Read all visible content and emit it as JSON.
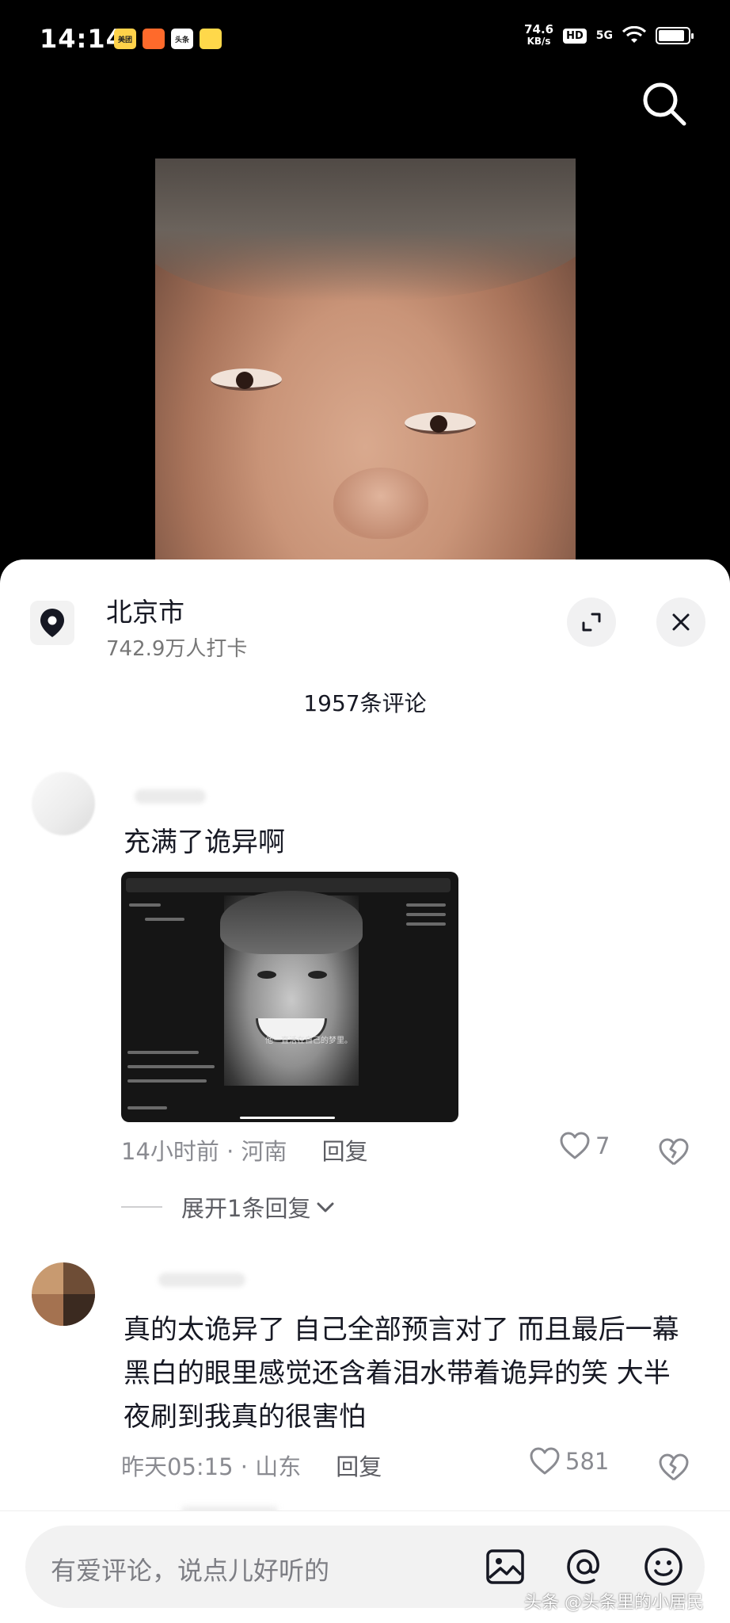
{
  "status_bar": {
    "time": "14:14",
    "app_badges": [
      "美团",
      "头条"
    ],
    "net_speed_value": "74.6",
    "net_speed_unit": "KB/s",
    "hd": "HD",
    "signal": "5G",
    "battery_level": 0.9
  },
  "location": {
    "name": "北京市",
    "checkins": "742.9万人打卡"
  },
  "comments_header": {
    "count_label": "1957条评论"
  },
  "comments": [
    {
      "text": "充满了诡异啊",
      "time_location": "14小时前 · 河南",
      "reply_label": "回复",
      "likes": "7",
      "expand_replies": "展开1条回复",
      "image_caption": "他一直活在自己的梦里。"
    },
    {
      "text": "真的太诡异了 自己全部预言对了 而且最后一幕黑白的眼里感觉还含着泪水带着诡异的笑 大半夜刷到我真的很害怕",
      "time_location": "昨天05:15 · 山东",
      "reply_label": "回复",
      "likes": "581"
    }
  ],
  "input_bar": {
    "placeholder": "有爱评论，说点儿好听的"
  },
  "watermark": "头条 @头条里的小居民",
  "colors": {
    "sheet_bg": "#ffffff",
    "text_primary": "#161823",
    "text_secondary": "#8a8b91",
    "page_bg": "#000000"
  }
}
